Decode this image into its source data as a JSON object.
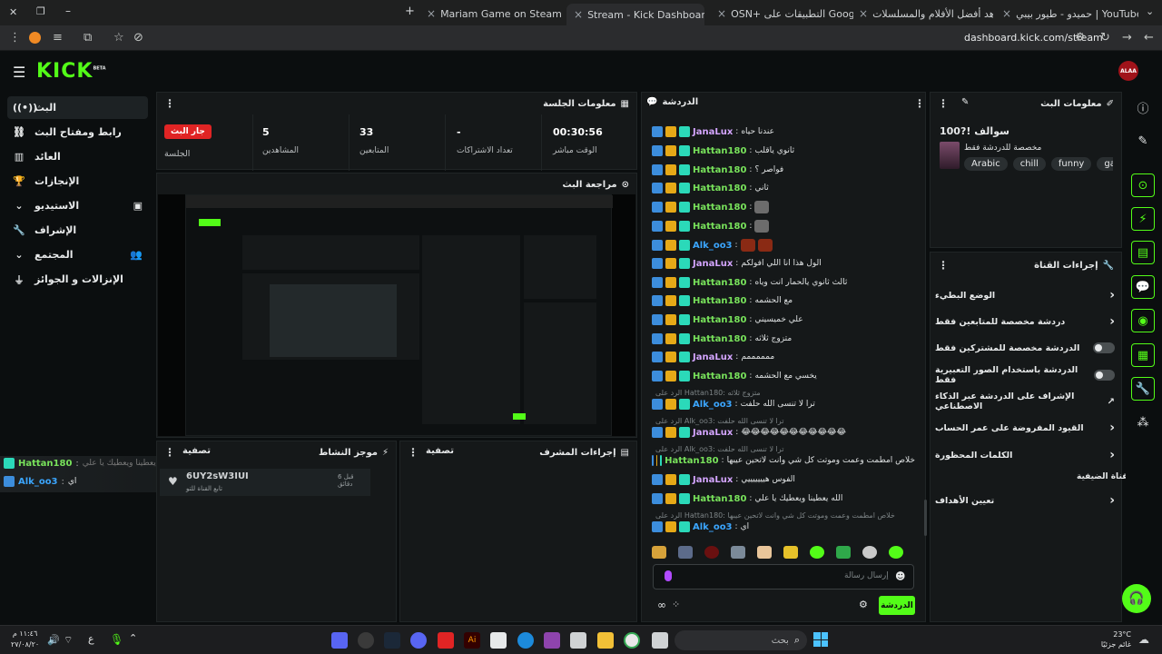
{
  "browser": {
    "tabs": [
      {
        "title": "Mariam Game on Steam"
      },
      {
        "title": "Stream - Kick Dashboard",
        "active": true
      },
      {
        "title": "OSN+ التطبيقات على Google"
      },
      {
        "title": "شاهد أفضل الأفلام والمسلسلات"
      },
      {
        "title": "حميدو - طيور بيبي | YouTube - y"
      }
    ],
    "url": "dashboard.kick.com/stream"
  },
  "app": {
    "logo": "KICK",
    "logo_sup": "BETA",
    "avatar": "ALAA"
  },
  "nav": [
    {
      "label": "البث",
      "icon": "broadcast-icon"
    },
    {
      "label": "رابط ومفتاح البث",
      "icon": "link-icon"
    },
    {
      "label": "العائد",
      "icon": "revenue-icon"
    },
    {
      "label": "الإنجازات",
      "icon": "trophy-icon"
    },
    {
      "label": "الاستيديو",
      "icon": "studio-icon"
    },
    {
      "label": "الإشراف",
      "icon": "wrench-icon"
    },
    {
      "label": "المجتمع",
      "icon": "community-icon"
    },
    {
      "label": "الإنزالات و الجوائز",
      "icon": "drops-icon"
    }
  ],
  "session": {
    "title": "معلومات الجلسة",
    "live_badge": "جار البث",
    "session_label": "الجلسة",
    "stats": [
      {
        "value": "00:30:56",
        "label": "الوقت مباشر"
      },
      {
        "value": "-",
        "label": "تعداد الاشتراكات"
      },
      {
        "value": "33",
        "label": "المتابعين"
      },
      {
        "value": "5",
        "label": "المشاهدين"
      }
    ]
  },
  "preview": {
    "title": "مراجعة البث"
  },
  "activity": {
    "title": "موجز النشاط",
    "filter": "تصفية",
    "item_name": "6UY2sW3IUI",
    "item_sub": "تابع القناة للتو",
    "item_time": "قبل 6 دقائق"
  },
  "mod_actions": {
    "title": "إجراءات المشرف",
    "filter": "تصفية"
  },
  "overlay_chat": [
    {
      "user": "Hattan180",
      "text": "الله يعطينا ويعطيك يا علي"
    },
    {
      "user": "Alk_oo3",
      "text": "اي"
    }
  ],
  "chat": {
    "title": "الدردشة",
    "messages": [
      {
        "user": "JanaLux",
        "text": "عندنا حياه",
        "color": "#d4a5ff"
      },
      {
        "user": "Hattan180",
        "text": "ثانوي ياقلب",
        "color": "#78e25b"
      },
      {
        "user": "Hattan180",
        "text": "فواصر ؟",
        "color": "#78e25b"
      },
      {
        "user": "Hattan180",
        "text": "ثاني",
        "color": "#78e25b"
      },
      {
        "user": "Hattan180",
        "text": "",
        "emote": true,
        "color": "#78e25b"
      },
      {
        "user": "Hattan180",
        "text": "",
        "emote": true,
        "color": "#78e25b"
      },
      {
        "user": "Alk_oo3",
        "text": "",
        "emote2": true,
        "color": "#3ba6ff"
      },
      {
        "user": "JanaLux",
        "text": "الول هذا انا اللي افولكم",
        "color": "#d4a5ff"
      },
      {
        "user": "Hattan180",
        "text": "ثالث ثانوي يالحمار انت وياه",
        "color": "#78e25b"
      },
      {
        "user": "Hattan180",
        "text": "مع الحشمه",
        "color": "#78e25b"
      },
      {
        "user": "Hattan180",
        "text": "علي خميسيني",
        "color": "#78e25b"
      },
      {
        "user": "Hattan180",
        "text": "متزوج ثلاثه",
        "color": "#78e25b"
      },
      {
        "user": "JanaLux",
        "text": "ممممممم",
        "color": "#d4a5ff"
      },
      {
        "user": "Hattan180",
        "text": "يخسي مع الحشمه",
        "color": "#78e25b"
      }
    ],
    "reply1": {
      "meta": "الرد على Hattan180: متزوج ثلاثه",
      "user": "Alk_oo3",
      "text": "ترا لا تنسى الله حلفت"
    },
    "reply2": {
      "meta": "الرد على Alk_oo3: ترا لا تنسى الله حلفت",
      "user": "JanaLux",
      "text": "😂😂😂😂😂😂😂😂😂😂😂"
    },
    "reply3": {
      "meta": "الرد على Alk_oo3: ترا لا تنسى الله حلفت",
      "user": "Hattan180",
      "text": "خلاص امطمت وعمت وموتت كل شي وانت لاتحين عيبها"
    },
    "after": [
      {
        "user": "JanaLux",
        "text": "الفوس هيييييييي",
        "color": "#d4a5ff"
      },
      {
        "user": "Hattan180",
        "text": "الله يعطينا ويعطيك يا علي",
        "color": "#78e25b"
      }
    ],
    "reply4": {
      "meta": "الرد على Hattan180: خلاص امطمت وعمت وموتت كل شي وانت لاتحين عيبها",
      "user": "Alk_oo3",
      "text": "اي"
    },
    "input_placeholder": "إرسال رسالة",
    "send_button": "الدردشة"
  },
  "stream_info": {
    "title": "معلومات البث",
    "stream_title": "سوالف !?100",
    "category": "مخصصة للدردشة فقط",
    "tags": [
      "Arabic",
      "chill",
      "funny",
      "gameplay"
    ]
  },
  "channel_actions": {
    "title": "إجراءات القناة",
    "rows": [
      {
        "label": "الوضع البطيء",
        "type": "chevron"
      },
      {
        "label": "دردشة مخصصة للمتابعين فقط",
        "type": "chevron"
      },
      {
        "label": "الدردشة مخصصة للمشتركين فقط",
        "type": "toggle"
      },
      {
        "label": "الدردشة باستخدام الصور التعبيرية فقط",
        "type": "toggle"
      },
      {
        "label": "الإشراف على الدردشة عبر الذكاء الاصطناعي",
        "type": "external"
      },
      {
        "label": "القيود المفروضة على عمر الحساب",
        "type": "chevron"
      },
      {
        "label": "الكلمات المحظورة",
        "type": "chevron"
      }
    ],
    "section": "القناة الضيفية",
    "target_row": "تعيين الأهداف"
  },
  "taskbar": {
    "search": "بحث",
    "time": "١١:٤٦ م",
    "date": "٢٧/٠٨/٢٠",
    "lang": "ع",
    "weather_temp": "23°C",
    "weather_text": "غائم جزئيًا"
  },
  "colors": {
    "accent": "#53fc18",
    "live": "#e02424",
    "panel": "#151819"
  }
}
